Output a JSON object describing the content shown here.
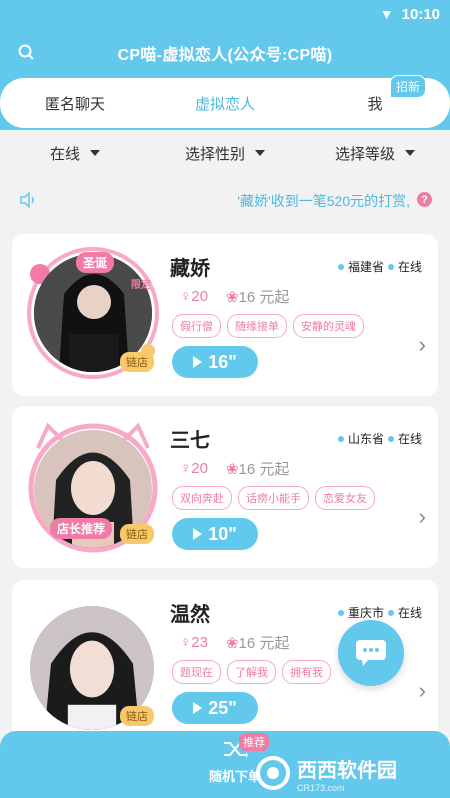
{
  "status": {
    "time": "10:10"
  },
  "header": {
    "title": "CP喵-虚拟恋人(公众号:CP喵)"
  },
  "tabs": [
    {
      "label": "匿名聊天",
      "active": false
    },
    {
      "label": "虚拟恋人",
      "active": true
    },
    {
      "label": "我",
      "active": false,
      "badge": "招新"
    }
  ],
  "filters": [
    {
      "label": "在线"
    },
    {
      "label": "选择性别"
    },
    {
      "label": "选择等级"
    }
  ],
  "notice": {
    "text": "'藏娇'收到一笔520元的打赏,",
    "help": "?"
  },
  "cards": [
    {
      "name": "藏娇",
      "province": "福建省",
      "status": "在线",
      "age": "20",
      "price": "16 元起",
      "tags": [
        "假行僧",
        "随缘接单",
        "安静的灵魂"
      ],
      "voice": "16\"",
      "shop": "链店",
      "frame_label": "圣诞",
      "frame_sub": "限定"
    },
    {
      "name": "三七",
      "province": "山东省",
      "status": "在线",
      "age": "20",
      "price": "16 元起",
      "tags": [
        "双向奔赴",
        "话痨小能手",
        "恋爱女友"
      ],
      "voice": "10\"",
      "shop": "链店",
      "frame_label": "店长推荐"
    },
    {
      "name": "温然",
      "province": "重庆市",
      "status": "在线",
      "age": "23",
      "price": "16 元起",
      "tags": [
        "题现在",
        "了解我",
        "拥有我"
      ],
      "voice": "25\"",
      "shop": "链店"
    }
  ],
  "bottom": {
    "random_label": "随机下单",
    "recommend": "推荐"
  },
  "watermark": {
    "brand": "西西软件园",
    "sub": "CR173.com"
  },
  "colors": {
    "primary": "#62c8ec",
    "pink": "#f07ba7",
    "gold": "#f7c96a"
  }
}
